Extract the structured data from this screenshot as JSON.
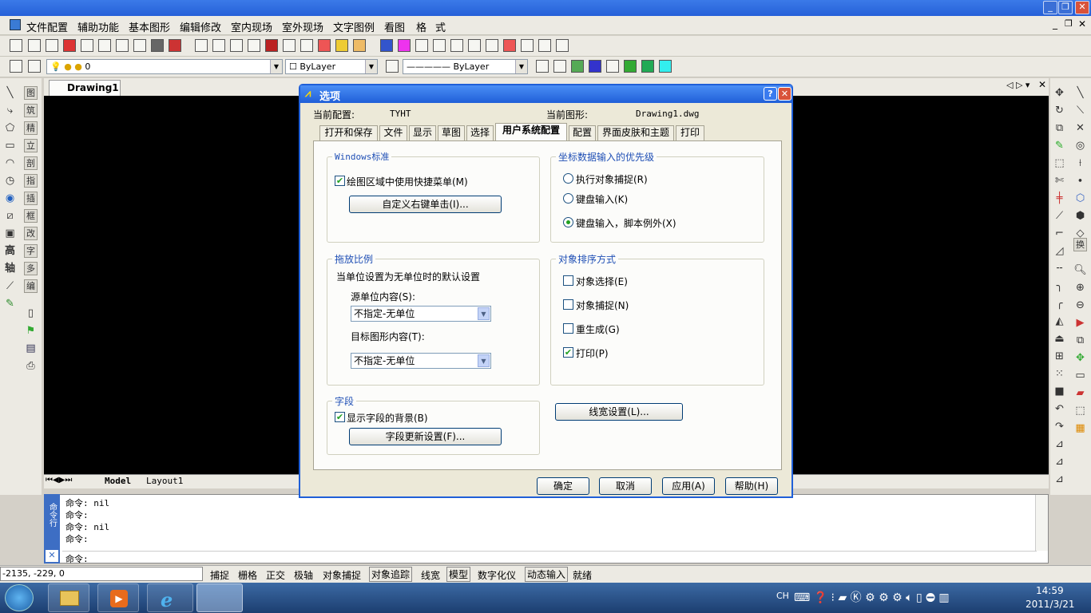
{
  "menu": [
    "文件配置",
    "辅助功能",
    "基本图形",
    "编辑修改",
    "室内现场",
    "室外现场",
    "文字图例",
    "看图",
    "格",
    "式"
  ],
  "layer_toolbar": {
    "layer_value": "0",
    "color_value": "ByLayer",
    "linetype_value": "ByLayer"
  },
  "drawing_tab": "Drawing1",
  "left_cn_icons": [
    "图",
    "筑",
    "精",
    "立",
    "剖",
    "指",
    "插",
    "框",
    "改",
    "字",
    "多",
    "编"
  ],
  "left_big_icons": [
    "高",
    "轴"
  ],
  "right_icon_label": "换",
  "layout_tabs": {
    "model": "Model",
    "layout": "Layout1"
  },
  "command": {
    "side_label": "命令行",
    "lines": [
      "命令: nil",
      "命令:",
      "命令: nil",
      "命令:"
    ],
    "prompt": "命令:"
  },
  "statusbar": {
    "coords": "-2135, -229, 0",
    "toggles": [
      "捕捉",
      "栅格",
      "正交",
      "极轴",
      "对象捕捉",
      "对象追踪",
      "线宽",
      "模型",
      "数字化仪",
      "动态输入"
    ],
    "state": "就绪"
  },
  "taskbar": {
    "lang": "CH",
    "time": "14:59",
    "date": "2011/3/21"
  },
  "dialog": {
    "title": "选项",
    "current_profile_label": "当前配置:",
    "current_profile": "TYHT",
    "current_drawing_label": "当前图形:",
    "current_drawing": "Drawing1.dwg",
    "tabs": [
      "打开和保存",
      "文件",
      "显示",
      "草图",
      "选择",
      "用户系统配置",
      "配置",
      "界面皮肤和主题",
      "打印"
    ],
    "windows_std": {
      "title": "Windows标准",
      "shortcut_menu": "绘图区域中使用快捷菜单(M)",
      "right_click_btn": "自定义右键单击(I)..."
    },
    "scale": {
      "title": "拖放比例",
      "desc": "当单位设置为无单位时的默认设置",
      "source_label": "源单位内容(S):",
      "source_value": "不指定-无单位",
      "target_label": "目标图形内容(T):",
      "target_value": "不指定-无单位"
    },
    "field": {
      "title": "字段",
      "show_bg": "显示字段的背景(B)",
      "update_btn": "字段更新设置(F)..."
    },
    "coord_priority": {
      "title": "坐标数据输入的优先级",
      "options": [
        "执行对象捕捉(R)",
        "键盘输入(K)",
        "键盘输入，脚本例外(X)"
      ],
      "selected": 2
    },
    "sort": {
      "title": "对象排序方式",
      "options": [
        "对象选择(E)",
        "对象捕捉(N)",
        "重生成(G)",
        "打印(P)"
      ],
      "checked": [
        false,
        false,
        false,
        true
      ]
    },
    "lineweight_btn": "线宽设置(L)...",
    "buttons": {
      "ok": "确定",
      "cancel": "取消",
      "apply": "应用(A)",
      "help": "帮助(H)"
    }
  }
}
